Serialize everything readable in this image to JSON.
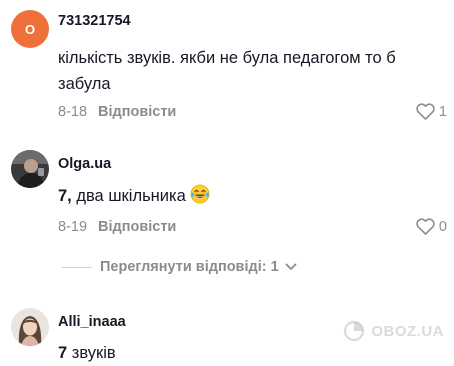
{
  "comments": [
    {
      "avatar_letter": "O",
      "username": "731321754",
      "text": "кількість звуків. якби не була педагогом то б забула",
      "date": "8-18",
      "reply_label": "Відповісти",
      "likes": "1"
    },
    {
      "username": "Olga.ua",
      "text_number": "7,",
      "text_rest": " два шкільника",
      "emoji": "face-with-tears-of-joy",
      "date": "8-19",
      "reply_label": "Відповісти",
      "likes": "0"
    },
    {
      "username": "Alli_inaaa",
      "text_number": "7",
      "text_rest": " звуків"
    }
  ],
  "view_replies": {
    "label": "Переглянути відповіді: 1",
    "icon": "chevron-down-icon"
  },
  "watermark": {
    "text": "OBOZ.UA",
    "icon": "oboz-logo-icon"
  },
  "colors": {
    "avatar_orange": "#f0703c",
    "muted_text": "#8a8b91",
    "primary_text": "#161823"
  }
}
